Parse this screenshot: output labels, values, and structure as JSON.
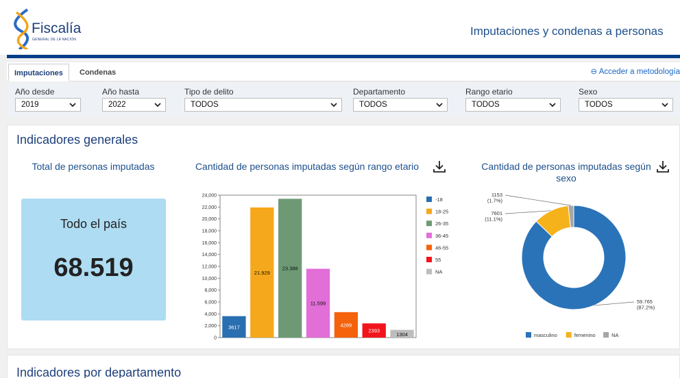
{
  "header": {
    "logo_text": "Fiscalía",
    "logo_subtext": "GENERAL DE LA NACIÓN",
    "page_title": "Imputaciones y condenas a personas"
  },
  "tabs": [
    {
      "label": "Imputaciones",
      "active": true
    },
    {
      "label": "Condenas",
      "active": false
    }
  ],
  "metodologia_link": "Acceder a metodología",
  "filters": [
    {
      "label": "Año desde",
      "value": "2019"
    },
    {
      "label": "Año hasta",
      "value": "2022"
    },
    {
      "label": "Tipo de delito",
      "value": "TODOS"
    },
    {
      "label": "Departamento",
      "value": "TODOS"
    },
    {
      "label": "Rango etario",
      "value": "TODOS"
    },
    {
      "label": "Sexo",
      "value": "TODOS"
    }
  ],
  "indicators": {
    "section_title": "Indicadores generales",
    "total_title": "Total de personas imputadas",
    "total_scope": "Todo el país",
    "total_value": "68.519",
    "age_chart_title": "Cantidad de personas imputadas según rango etario",
    "sex_chart_title": "Cantidad de personas imputadas según sexo"
  },
  "section2_title": "Indicadores por departamento",
  "chart_data": [
    {
      "type": "bar",
      "title": "Cantidad de personas imputadas según rango etario",
      "categories": [
        "-18",
        "18-25",
        "26-35",
        "36-45",
        "46-55",
        "55",
        "NA"
      ],
      "values": [
        3617,
        21929,
        23388,
        11599,
        4289,
        2393,
        1304
      ],
      "value_labels": [
        "3617",
        "21.929",
        "23.388",
        "11.599",
        "4289",
        "2393",
        "1304"
      ],
      "colors": [
        "#2a6fb0",
        "#f5a81b",
        "#6d9a75",
        "#e26ed8",
        "#f5620c",
        "#f2141c",
        "#bdbdbd"
      ],
      "ylim": [
        0,
        24000
      ],
      "yticks": [
        "0",
        "2,000",
        "4,000",
        "6,000",
        "8,000",
        "10,000",
        "12,000",
        "14,000",
        "16,000",
        "18,000",
        "20,000",
        "22,000",
        "24,000"
      ],
      "legend_position": "right"
    },
    {
      "type": "pie",
      "donut": true,
      "title": "Cantidad de personas imputadas según sexo",
      "labels": [
        "masculino",
        "femenino",
        "NA"
      ],
      "values": [
        59765,
        7601,
        1153
      ],
      "value_labels": [
        "59.765",
        "7601",
        "1153"
      ],
      "percent_labels": [
        "(87.2%)",
        "(11.1%)",
        "(1.7%)"
      ],
      "colors": [
        "#2b73b8",
        "#f5b21b",
        "#a6a6a6"
      ],
      "legend_position": "bottom"
    }
  ]
}
